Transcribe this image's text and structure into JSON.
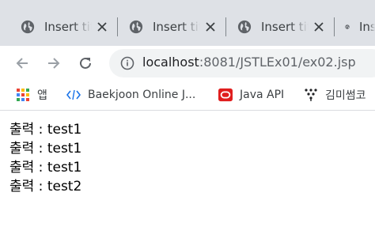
{
  "tabs": [
    {
      "title": "Insert title here"
    },
    {
      "title": "Insert title here"
    },
    {
      "title": "Insert title here"
    },
    {
      "title": "Insert title here"
    }
  ],
  "address_bar": {
    "host": "localhost",
    "path": ":8081/JSTLEx01/ex02.jsp"
  },
  "bookmarks": [
    {
      "label": "앱",
      "icon": "apps-grid-icon"
    },
    {
      "label": "Baekjoon Online J...",
      "icon": "code-brackets-icon"
    },
    {
      "label": "Java API",
      "icon": "oracle-icon"
    },
    {
      "label": "김미썸코",
      "icon": "tree-icon"
    }
  ],
  "output_lines": [
    "출력 : test1",
    "출력 : test1",
    "출력 : test1",
    "출력 : test2"
  ],
  "colors": {
    "tabstrip_bg": "#dee1e6",
    "omnibox_bg": "#f1f3f4",
    "oracle_red": "#e01e1e",
    "code_blue": "#1a73e8"
  }
}
